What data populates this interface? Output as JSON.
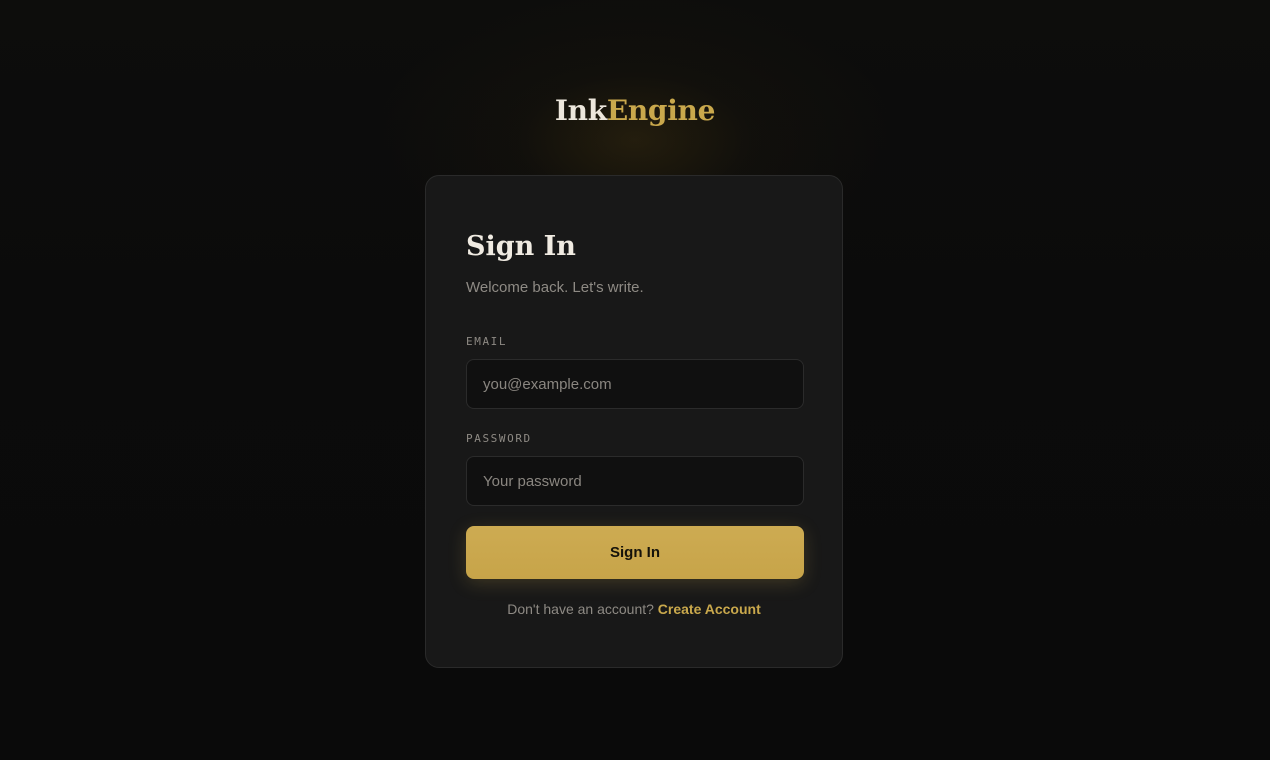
{
  "brand": {
    "name_part1": "Ink",
    "name_part2": "Engine",
    "accent_color": "#c9a84c"
  },
  "signin": {
    "title": "Sign In",
    "subtitle": "Welcome back. Let's write.",
    "email": {
      "label": "EMAIL",
      "placeholder": "you@example.com",
      "value": ""
    },
    "password": {
      "label": "PASSWORD",
      "placeholder": "Your password",
      "value": ""
    },
    "submit_label": "Sign In",
    "footer_text": "Don't have an account?",
    "create_account_label": "Create Account"
  }
}
